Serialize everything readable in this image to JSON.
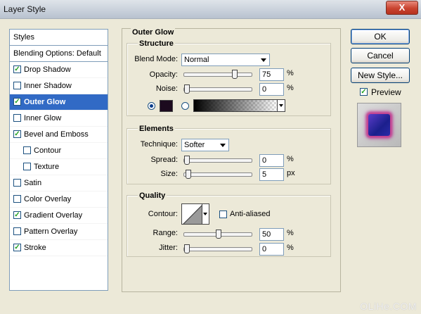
{
  "window": {
    "title": "Layer Style",
    "close_label": "X"
  },
  "styles_panel": {
    "header": "Styles",
    "blending": "Blending Options: Default",
    "items": [
      {
        "label": "Drop Shadow",
        "checked": true
      },
      {
        "label": "Inner Shadow",
        "checked": false
      },
      {
        "label": "Outer Glow",
        "checked": true,
        "selected": true
      },
      {
        "label": "Inner Glow",
        "checked": false
      },
      {
        "label": "Bevel and Emboss",
        "checked": true
      },
      {
        "label": "Contour",
        "checked": false,
        "sub": true
      },
      {
        "label": "Texture",
        "checked": false,
        "sub": true
      },
      {
        "label": "Satin",
        "checked": false
      },
      {
        "label": "Color Overlay",
        "checked": false
      },
      {
        "label": "Gradient Overlay",
        "checked": true
      },
      {
        "label": "Pattern Overlay",
        "checked": false
      },
      {
        "label": "Stroke",
        "checked": true
      }
    ]
  },
  "outer_glow": {
    "title": "Outer Glow",
    "structure": {
      "title": "Structure",
      "blend_mode_label": "Blend Mode:",
      "blend_mode_value": "Normal",
      "opacity_label": "Opacity:",
      "opacity_value": "75",
      "opacity_fraction": 0.75,
      "noise_label": "Noise:",
      "noise_value": "0",
      "noise_fraction": 0,
      "percent": "%",
      "glow_color": "#1c0a1e"
    },
    "elements": {
      "title": "Elements",
      "technique_label": "Technique:",
      "technique_value": "Softer",
      "spread_label": "Spread:",
      "spread_value": "0",
      "spread_fraction": 0,
      "size_label": "Size:",
      "size_value": "5",
      "size_fraction": 0.02,
      "percent": "%",
      "px": "px"
    },
    "quality": {
      "title": "Quality",
      "contour_label": "Contour:",
      "anti_aliased_label": "Anti-aliased",
      "anti_aliased_checked": false,
      "range_label": "Range:",
      "range_value": "50",
      "range_fraction": 0.5,
      "jitter_label": "Jitter:",
      "jitter_value": "0",
      "jitter_fraction": 0,
      "percent": "%"
    }
  },
  "buttons": {
    "ok": "OK",
    "cancel": "Cancel",
    "new_style": "New Style..."
  },
  "preview": {
    "label": "Preview",
    "checked": true
  },
  "watermark": "OLiHe.COM"
}
